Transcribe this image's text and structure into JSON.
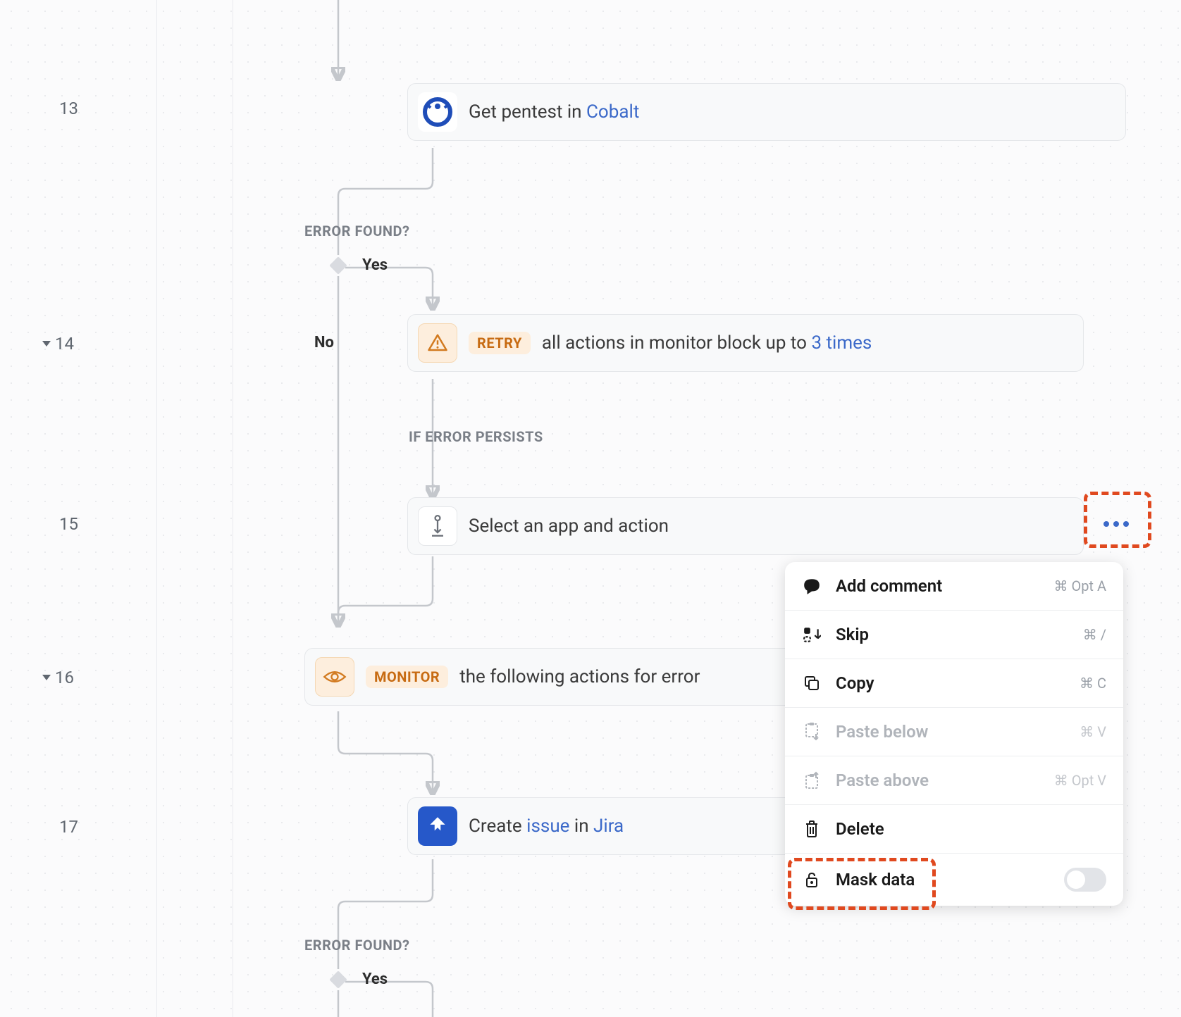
{
  "steps": {
    "s13": "13",
    "s14": "14",
    "s15": "15",
    "s16": "16",
    "s17": "17"
  },
  "cards": {
    "cobalt": {
      "prefix": "Get pentest in ",
      "link": "Cobalt"
    },
    "retry": {
      "badge": "RETRY",
      "text": " all actions in monitor block up to ",
      "link": "3 times"
    },
    "select": {
      "text": "Select an app and action"
    },
    "monitor": {
      "badge": "MONITOR",
      "text": " the following actions for error"
    },
    "jira": {
      "prefix": "Create ",
      "link": "issue",
      "suffix": " in ",
      "link2": "Jira"
    }
  },
  "labels": {
    "error_found": "ERROR FOUND?",
    "yes": "Yes",
    "no": "No",
    "if_persists": "IF ERROR PERSISTS"
  },
  "menu": {
    "add_comment": {
      "label": "Add comment",
      "shortcut": "⌘ Opt A"
    },
    "skip": {
      "label": "Skip",
      "shortcut": "⌘ /"
    },
    "copy": {
      "label": "Copy",
      "shortcut": "⌘ C"
    },
    "paste_below": {
      "label": "Paste below",
      "shortcut": "⌘ V"
    },
    "paste_above": {
      "label": "Paste above",
      "shortcut": "⌘ Opt V"
    },
    "delete": {
      "label": "Delete"
    },
    "mask": {
      "label": "Mask data"
    }
  }
}
